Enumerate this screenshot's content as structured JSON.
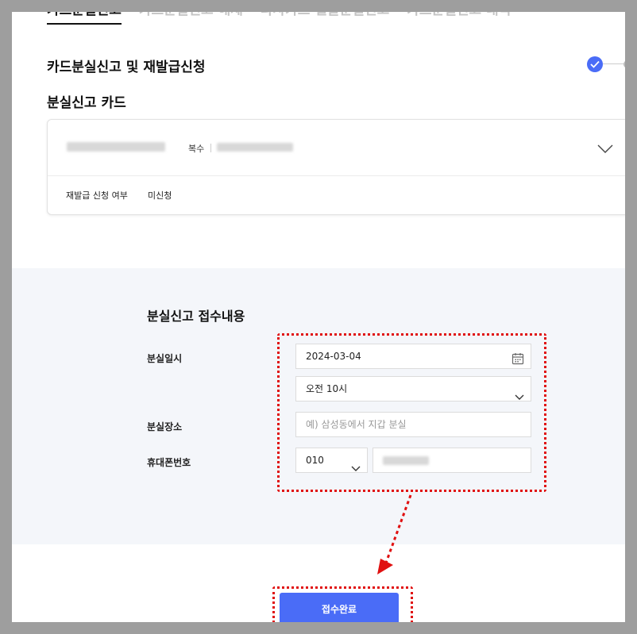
{
  "tabs": [
    {
      "label": "카드분실신고",
      "active": true
    },
    {
      "label": "카드분실신고 해제",
      "active": false
    },
    {
      "label": "타사카드 일괄분실신고",
      "active": false
    },
    {
      "label": "카드분실신고 내역",
      "active": false
    }
  ],
  "step_title": "카드분실신고 및 재발급신청",
  "section_title": "분실신고 카드",
  "card": {
    "multi_label": "복수",
    "reissue_label": "재발급 신청 여부",
    "reissue_value": "미신청"
  },
  "form": {
    "title": "분실신고 접수내용",
    "loss_datetime_label": "분실일시",
    "date_value": "2024-03-04",
    "time_value": "오전 10시",
    "place_label": "분실장소",
    "place_placeholder": "예) 삼성동에서 지갑 분실",
    "phone_label": "휴대폰번호",
    "phone_prefix": "010"
  },
  "submit_label": "접수완료",
  "colors": {
    "accent": "#4a6cf7",
    "highlight": "#e01010",
    "band": "#f4f6fa"
  }
}
